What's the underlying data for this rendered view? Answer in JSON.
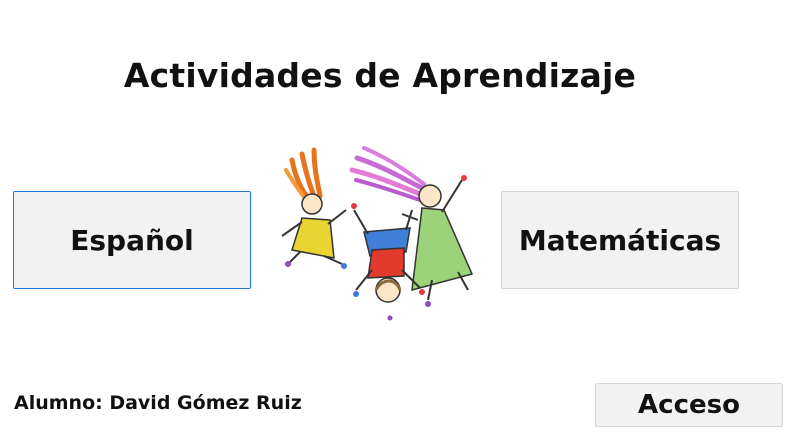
{
  "page": {
    "title": "Actividades de Aprendizaje"
  },
  "subjects": {
    "espanol_label": "Español",
    "matematicas_label": "Matemáticas"
  },
  "footer": {
    "student_label": "Alumno: David Gómez Ruiz",
    "access_label": "Acceso"
  },
  "illustration": {
    "icon": "playing-children-icon"
  },
  "colors": {
    "focus_border": "#1e7ad6",
    "button_bg": "#f2f2f2"
  }
}
